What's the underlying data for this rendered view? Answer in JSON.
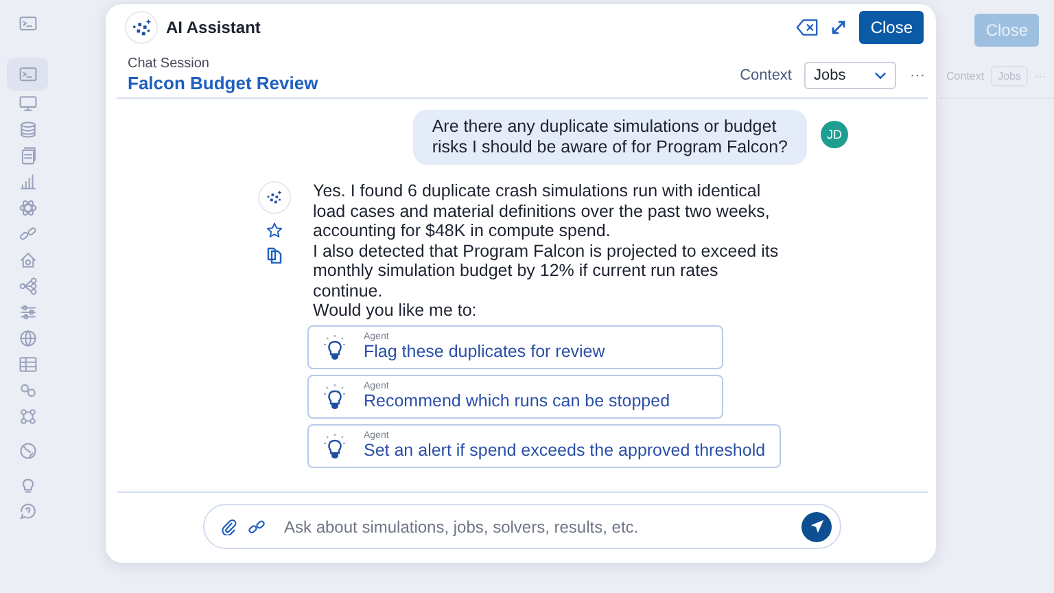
{
  "sidebar": {
    "items": [
      {
        "selected": false
      },
      {
        "selected": true
      },
      {
        "selected": false
      },
      {
        "selected": false
      },
      {
        "selected": false
      },
      {
        "selected": false
      },
      {
        "selected": false
      },
      {
        "selected": false
      },
      {
        "selected": false
      },
      {
        "selected": false
      },
      {
        "selected": false
      },
      {
        "selected": false
      },
      {
        "selected": false
      },
      {
        "selected": false
      },
      {
        "selected": false
      },
      {
        "selected": false
      },
      {
        "selected": false
      },
      {
        "selected": false
      }
    ]
  },
  "background": {
    "close_button": "Close",
    "context_label": "Context",
    "context_value": "Jobs",
    "more": "···"
  },
  "assistant": {
    "title": "AI Assistant",
    "close_button": "Close",
    "session_label": "Chat Session",
    "session_name": "Falcon Budget Review",
    "context_label": "Context",
    "context_value": "Jobs",
    "more": "···",
    "messages": [
      {
        "kind": "user",
        "avatar": "JD",
        "lines": [
          "Are there any duplicate simulations or budget",
          "risks I should be aware of for Program Falcon?"
        ]
      },
      {
        "kind": "assistant",
        "lines": [
          "Yes. I found 6 duplicate crash simulations run with identical",
          "load cases and material definitions over the past two weeks,",
          "accounting for $48K in compute spend.",
          "I also detected that Program Falcon is projected to exceed its",
          "monthly simulation budget by 12% if current run rates",
          "continue.",
          "Would you like me to:"
        ],
        "actions": [
          {
            "tag": "Agent",
            "label": "Flag these duplicates for review"
          },
          {
            "tag": "Agent",
            "label": "Recommend which runs can be stopped"
          },
          {
            "tag": "Agent",
            "label": "Set an alert if spend exceeds the approved threshold"
          }
        ]
      }
    ],
    "composer": {
      "placeholder": "Ask about simulations, jobs, solvers, results, etc."
    }
  }
}
